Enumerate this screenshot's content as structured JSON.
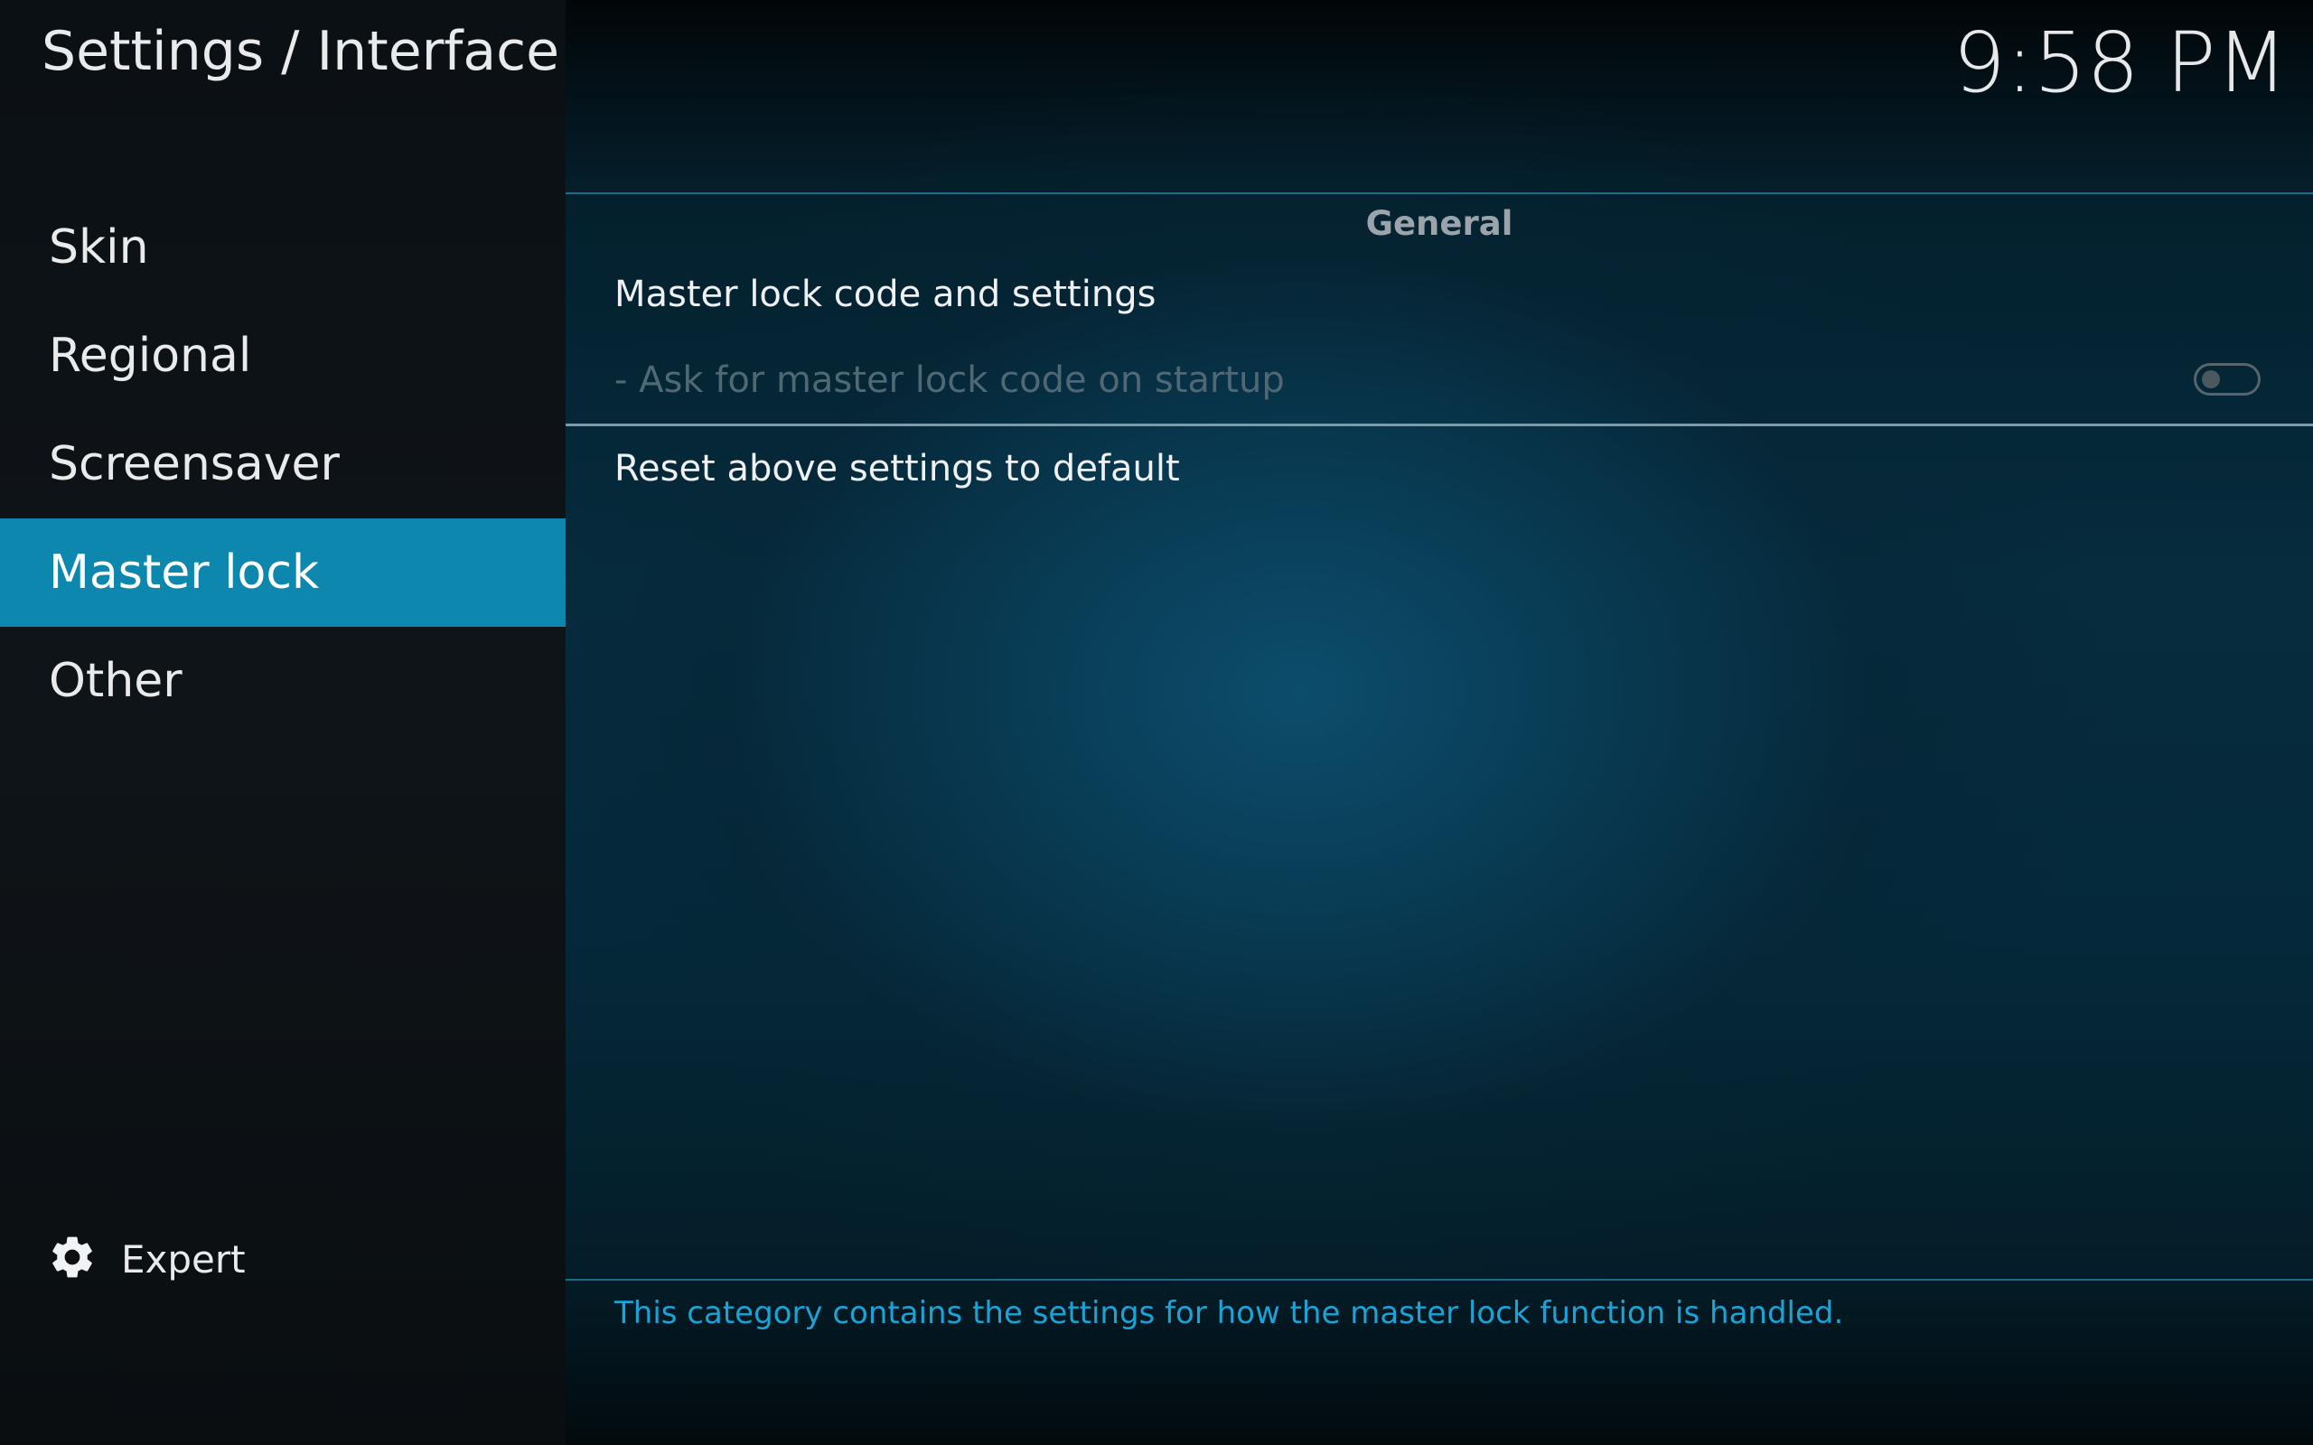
{
  "header": {
    "title": "Settings / Interface",
    "clock": "9:58 PM"
  },
  "sidebar": {
    "items": [
      {
        "label": "Skin",
        "active": false
      },
      {
        "label": "Regional",
        "active": false
      },
      {
        "label": "Screensaver",
        "active": false
      },
      {
        "label": "Master lock",
        "active": true
      },
      {
        "label": "Other",
        "active": false
      }
    ],
    "expert": {
      "label": "Expert",
      "icon": "gear-icon"
    }
  },
  "main": {
    "section_title": "General",
    "settings": [
      {
        "label": "Master lock code and settings"
      },
      {
        "label": "- Ask for master lock code on startup",
        "enabled": false,
        "toggle_on": false
      },
      {
        "label": "Reset above settings to default"
      }
    ],
    "description": "This category contains the settings for how the master lock function is handled."
  },
  "colors": {
    "accent": "#0d87ad",
    "description_text": "#1aa4d6",
    "disabled_text": "#4f6874"
  }
}
